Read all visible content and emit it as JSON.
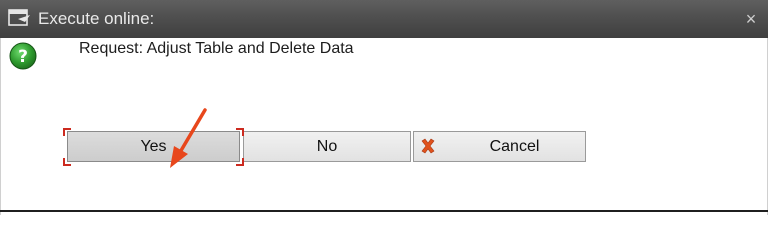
{
  "window": {
    "title": "Execute online:",
    "close_glyph": "×"
  },
  "dialog": {
    "message": "Request: Adjust Table and Delete Data",
    "icon": "question-icon"
  },
  "buttons": {
    "yes_label": "Yes",
    "no_label": "No",
    "cancel_label": "Cancel",
    "cancel_icon": "cancel-x-icon"
  },
  "annotations": {
    "arrow_color": "#e8471c",
    "highlight_color": "#cc2a1f"
  },
  "colors": {
    "titlebar": "#4f4f4f",
    "question_green": "#2e9a2e"
  }
}
